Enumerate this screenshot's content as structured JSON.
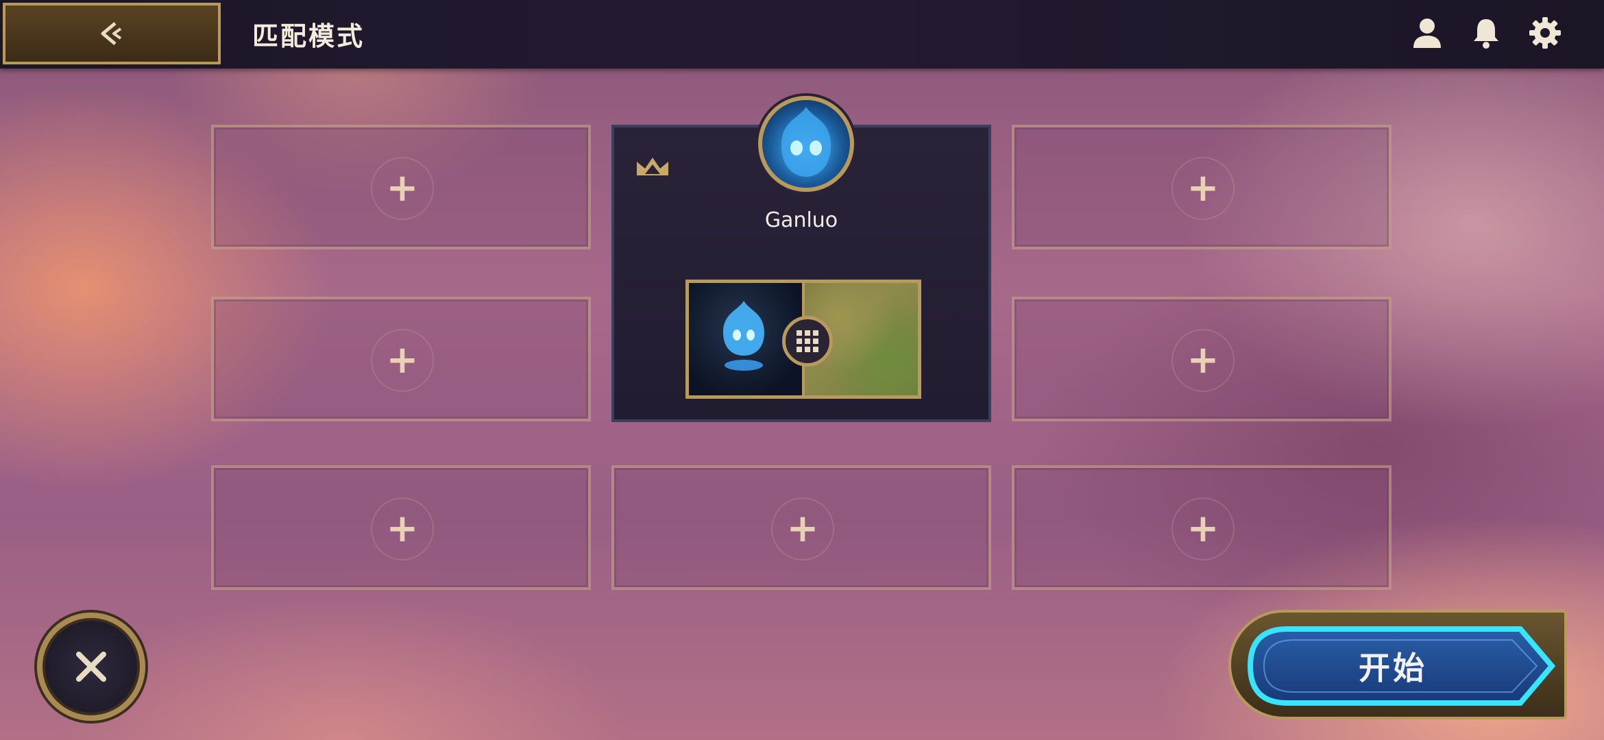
{
  "header": {
    "title": "匹配模式",
    "back_icon": "back-arrow-icon",
    "icons": [
      "user-icon",
      "bell-icon",
      "gear-icon"
    ]
  },
  "lobby": {
    "empty_slot_symbol": "+",
    "player": {
      "name": "Ganluo",
      "is_party_leader": true,
      "leader_icon": "crown-icon",
      "loadout_icon": "grid-icon"
    }
  },
  "footer": {
    "close_icon": "close-icon",
    "start_label": "开始"
  },
  "colors": {
    "gold": "#b89a5c",
    "topbar": "#1c1628",
    "start_glow": "#33e0ff"
  }
}
